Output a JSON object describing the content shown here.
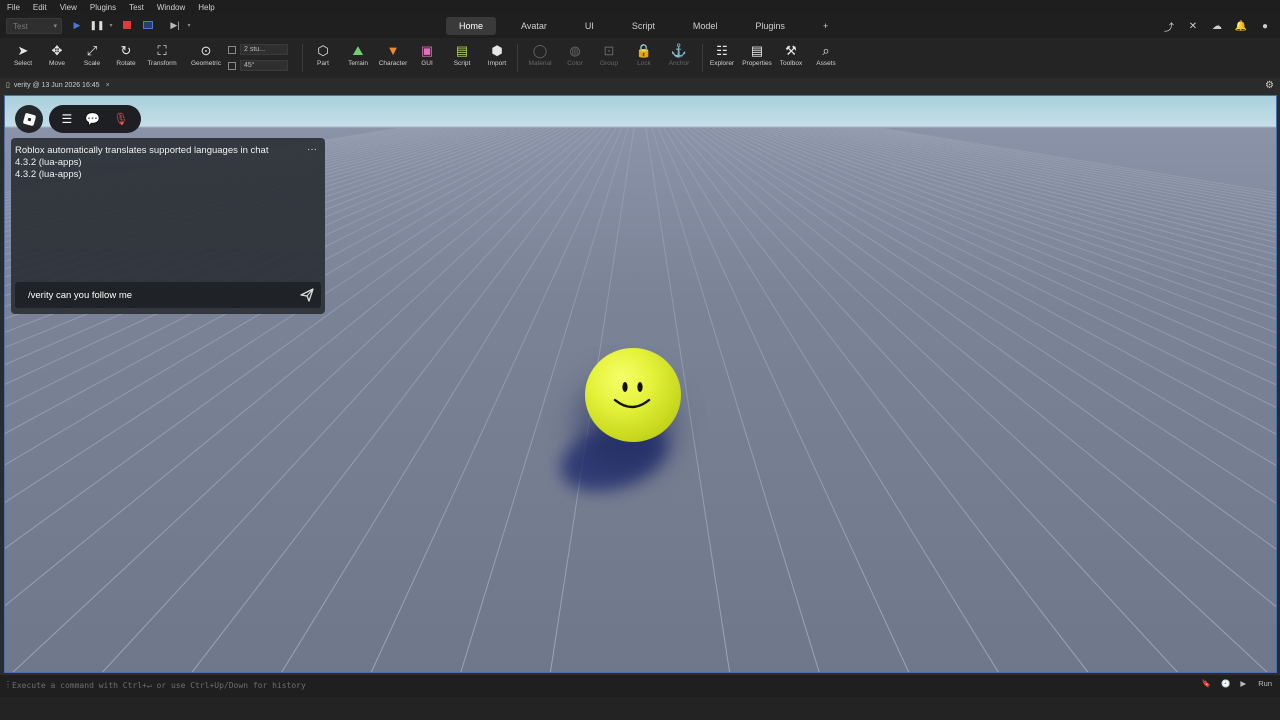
{
  "menu": [
    "File",
    "Edit",
    "View",
    "Plugins",
    "Test",
    "Window",
    "Help"
  ],
  "topbar": {
    "mode": "Test",
    "tabs": [
      "Home",
      "Avatar",
      "UI",
      "Script",
      "Model",
      "Plugins"
    ],
    "add_tab": "+",
    "active_tab": "Home"
  },
  "ribbon": {
    "tools": [
      {
        "label": "Select",
        "icon": "cursor-icon"
      },
      {
        "label": "Move",
        "icon": "move-icon"
      },
      {
        "label": "Scale",
        "icon": "scale-icon"
      },
      {
        "label": "Rotate",
        "icon": "rotate-icon"
      },
      {
        "label": "Transform",
        "icon": "transform-icon"
      },
      {
        "label": "Geometric",
        "icon": "geometric-icon"
      }
    ],
    "snap_move": "2 stu...",
    "snap_rotate": "45°",
    "insert_tools": [
      {
        "label": "Part"
      },
      {
        "label": "Terrain"
      },
      {
        "label": "Character"
      },
      {
        "label": "GUI"
      },
      {
        "label": "Script"
      },
      {
        "label": "Import"
      }
    ],
    "dim_tools": [
      {
        "label": "Material"
      },
      {
        "label": "Color"
      },
      {
        "label": "Group"
      },
      {
        "label": "Lock"
      },
      {
        "label": "Anchor"
      }
    ],
    "panel_tools": [
      {
        "label": "Explorer"
      },
      {
        "label": "Properties"
      },
      {
        "label": "Toolbox"
      },
      {
        "label": "Assets"
      }
    ]
  },
  "doc_tab": {
    "label": "verity @ 13 Jun 2026 16:45",
    "close": "×"
  },
  "chat": {
    "messages": [
      "Roblox automatically translates supported languages in chat",
      "4.3.2 (lua-apps)",
      "4.3.2 (lua-apps)"
    ],
    "more": "···",
    "input_value": "/verity can you follow me"
  },
  "command_bar": {
    "placeholder": "Execute a command with Ctrl+↵ or use Ctrl+Up/Down for history",
    "run_label": "Run"
  },
  "colors": {
    "accent_blue": "#4a6fb3",
    "play_red": "#e03b3b",
    "ball_yellow": "#e4f23a"
  }
}
